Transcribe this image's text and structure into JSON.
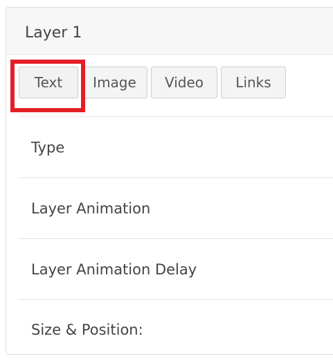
{
  "panel": {
    "title": "Layer 1"
  },
  "tabs": [
    {
      "label": "Text"
    },
    {
      "label": "Image"
    },
    {
      "label": "Video"
    },
    {
      "label": "Links"
    }
  ],
  "sections": [
    {
      "label": "Type"
    },
    {
      "label": "Layer Animation"
    },
    {
      "label": "Layer Animation Delay"
    },
    {
      "label": "Size & Position:"
    }
  ],
  "colors": {
    "highlight": "#e41e26"
  }
}
